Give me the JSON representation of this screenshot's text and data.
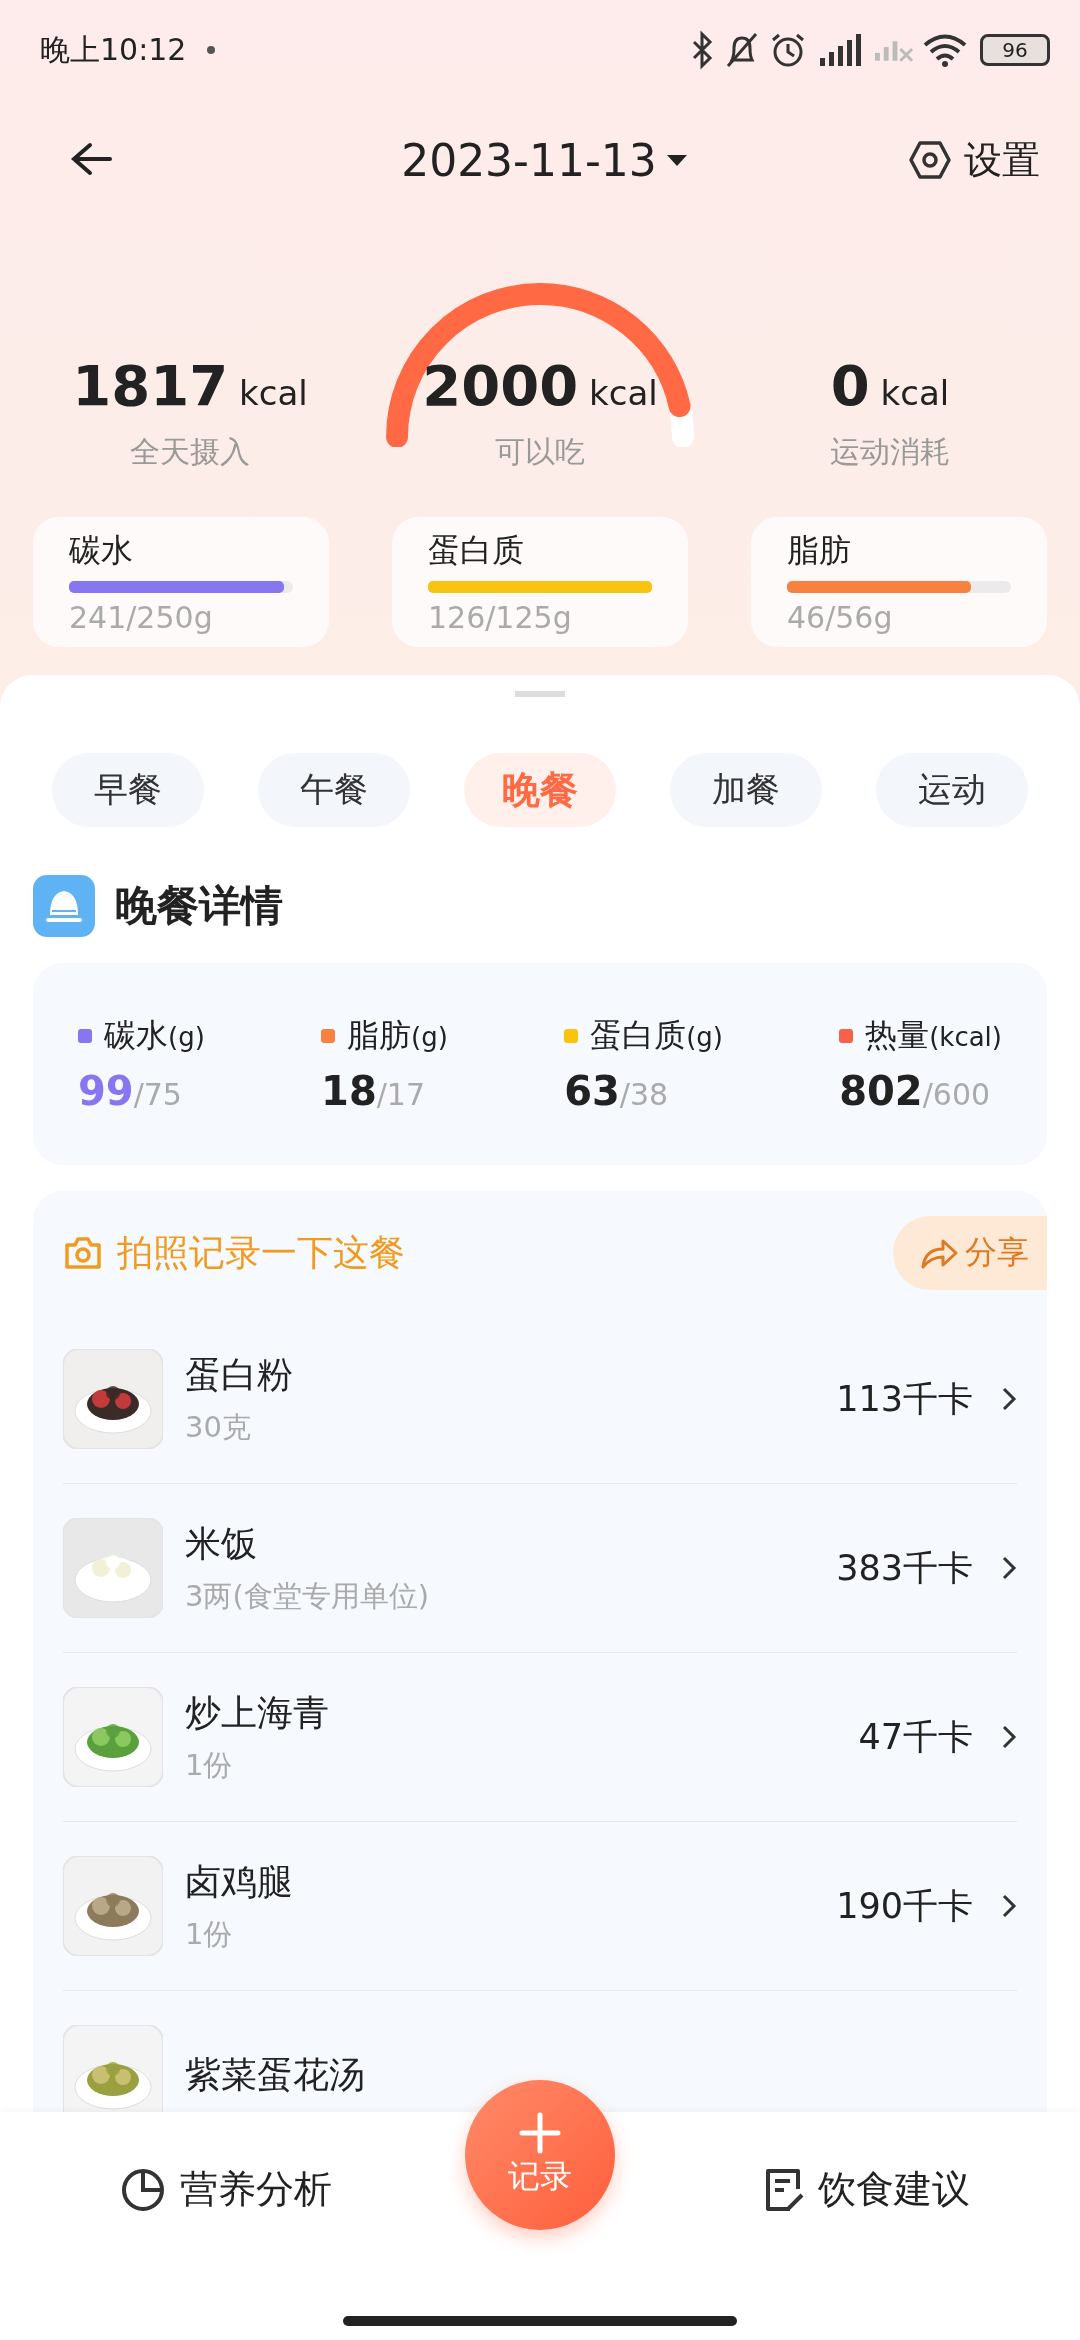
{
  "status_bar": {
    "time": "晚上10:12",
    "battery": "96"
  },
  "header": {
    "date": "2023-11-13",
    "settings": "设置"
  },
  "summary": {
    "intake": {
      "value": "1817",
      "unit": "kcal",
      "label": "全天摄入"
    },
    "remaining": {
      "value": "2000",
      "unit": "kcal",
      "label": "可以吃"
    },
    "burned": {
      "value": "0",
      "unit": "kcal",
      "label": "运动消耗"
    }
  },
  "macros": [
    {
      "name": "碳水",
      "reading": "241/250g",
      "level": 0.96,
      "color": "#8676f0"
    },
    {
      "name": "蛋白质",
      "reading": "126/125g",
      "level": 1,
      "color": "#f8c40f"
    },
    {
      "name": "脂肪",
      "reading": "46/56g",
      "level": 0.82,
      "color": "#f7823f"
    }
  ],
  "meal_tabs": [
    {
      "label": "早餐",
      "selected": false
    },
    {
      "label": "午餐",
      "selected": false
    },
    {
      "label": "晚餐",
      "selected": true
    },
    {
      "label": "加餐",
      "selected": false
    },
    {
      "label": "运动",
      "selected": false
    }
  ],
  "meal_detail": {
    "title": "晚餐详情",
    "stats": [
      {
        "label": "碳水",
        "unit": "(g)",
        "value": "99",
        "target": "/75",
        "color": "#8676f0",
        "highlight": true
      },
      {
        "label": "脂肪",
        "unit": "(g)",
        "value": "18",
        "target": "/17",
        "color": "#f7823f",
        "highlight": false
      },
      {
        "label": "蛋白质",
        "unit": "(g)",
        "value": "63",
        "target": "/38",
        "color": "#f8c40f",
        "highlight": false
      },
      {
        "label": "热量",
        "unit": "(kcal)",
        "value": "802",
        "target": "/600",
        "color": "#f7634a",
        "highlight": false
      }
    ]
  },
  "food_list": {
    "photo_prompt": "拍照记录一下这餐",
    "share": "分享",
    "items": [
      {
        "name": "蛋白粉",
        "amount": "30克",
        "calories": "113千卡",
        "kind": "picture"
      },
      {
        "name": "米饭",
        "amount": "3两(食堂专用单位)",
        "calories": "383千卡",
        "kind": "picture"
      },
      {
        "name": "炒上海青",
        "amount": "1份",
        "calories": "47千卡",
        "kind": "picture"
      },
      {
        "name": "卤鸡腿",
        "amount": "1份",
        "calories": "190千卡",
        "kind": "picture"
      },
      {
        "name": "紫菜蛋花汤",
        "kind": "picture"
      }
    ]
  },
  "bottom_nav": {
    "left": "营养分析",
    "center": "记录",
    "right": "饮食建议"
  }
}
